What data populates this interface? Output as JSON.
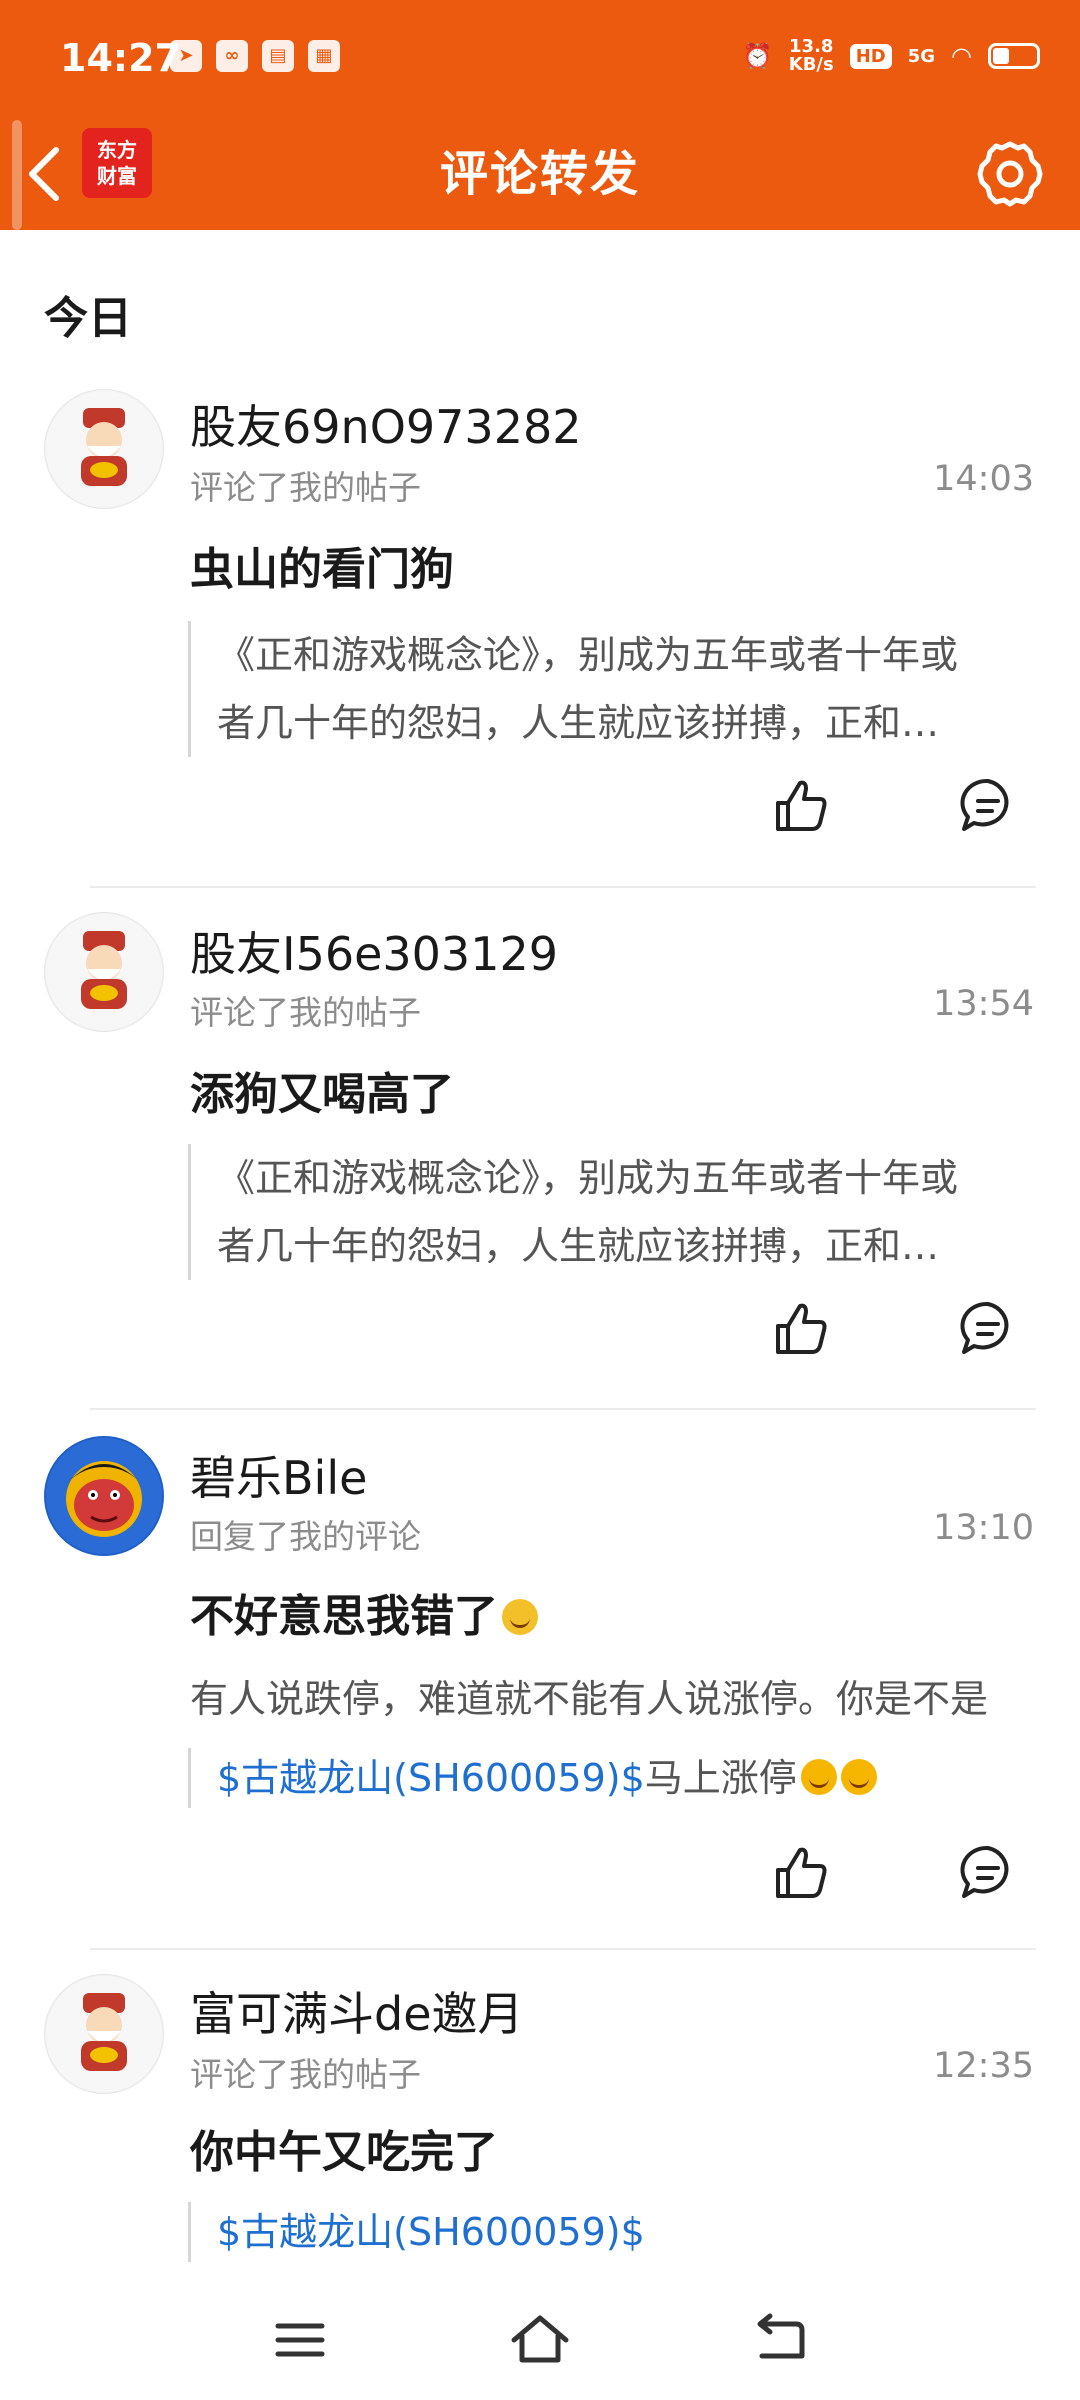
{
  "status": {
    "time": "14:27",
    "speed_top": "13.8",
    "speed_bottom": "KB/s",
    "hd": "HD",
    "net": "5G"
  },
  "header": {
    "title": "评论转发",
    "logo_line1": "东方",
    "logo_line2": "财富"
  },
  "section": {
    "today": "今日"
  },
  "items": [
    {
      "name": "股友69nO973282",
      "action": "评论了我的帖子",
      "time": "14:03",
      "comment": "虫山的看门狗",
      "quote_line1": "《正和游戏概念论》，别成为五年或者十年或",
      "quote_line2": "者几十年的怨妇，人生就应该拼搏，正和…"
    },
    {
      "name": "股友I56e303129",
      "action": "评论了我的帖子",
      "time": "13:54",
      "comment": "添狗又喝高了",
      "quote_line1": "《正和游戏概念论》，别成为五年或者十年或",
      "quote_line2": "者几十年的怨妇，人生就应该拼搏，正和…"
    },
    {
      "name": "碧乐Bile",
      "action": "回复了我的评论",
      "time": "13:10",
      "comment": "不好意思我错了",
      "orig_text": "有人说跌停，难道就不能有人说涨停。你是不是",
      "stock": "$古越龙山(SH600059)$",
      "stock_after": "马上涨停"
    },
    {
      "name": "富可满斗de邀月",
      "action": "评论了我的帖子",
      "time": "12:35",
      "comment": "你中午又吃完了",
      "stock": "$古越龙山(SH600059)$"
    }
  ],
  "colors": {
    "brand": "#eb5a0e",
    "link": "#1e6fd0"
  },
  "icons": [
    "back-arrow-icon",
    "gear-icon",
    "thumbs-up-icon",
    "comment-icon",
    "menu-icon",
    "home-icon",
    "back-nav-icon"
  ]
}
